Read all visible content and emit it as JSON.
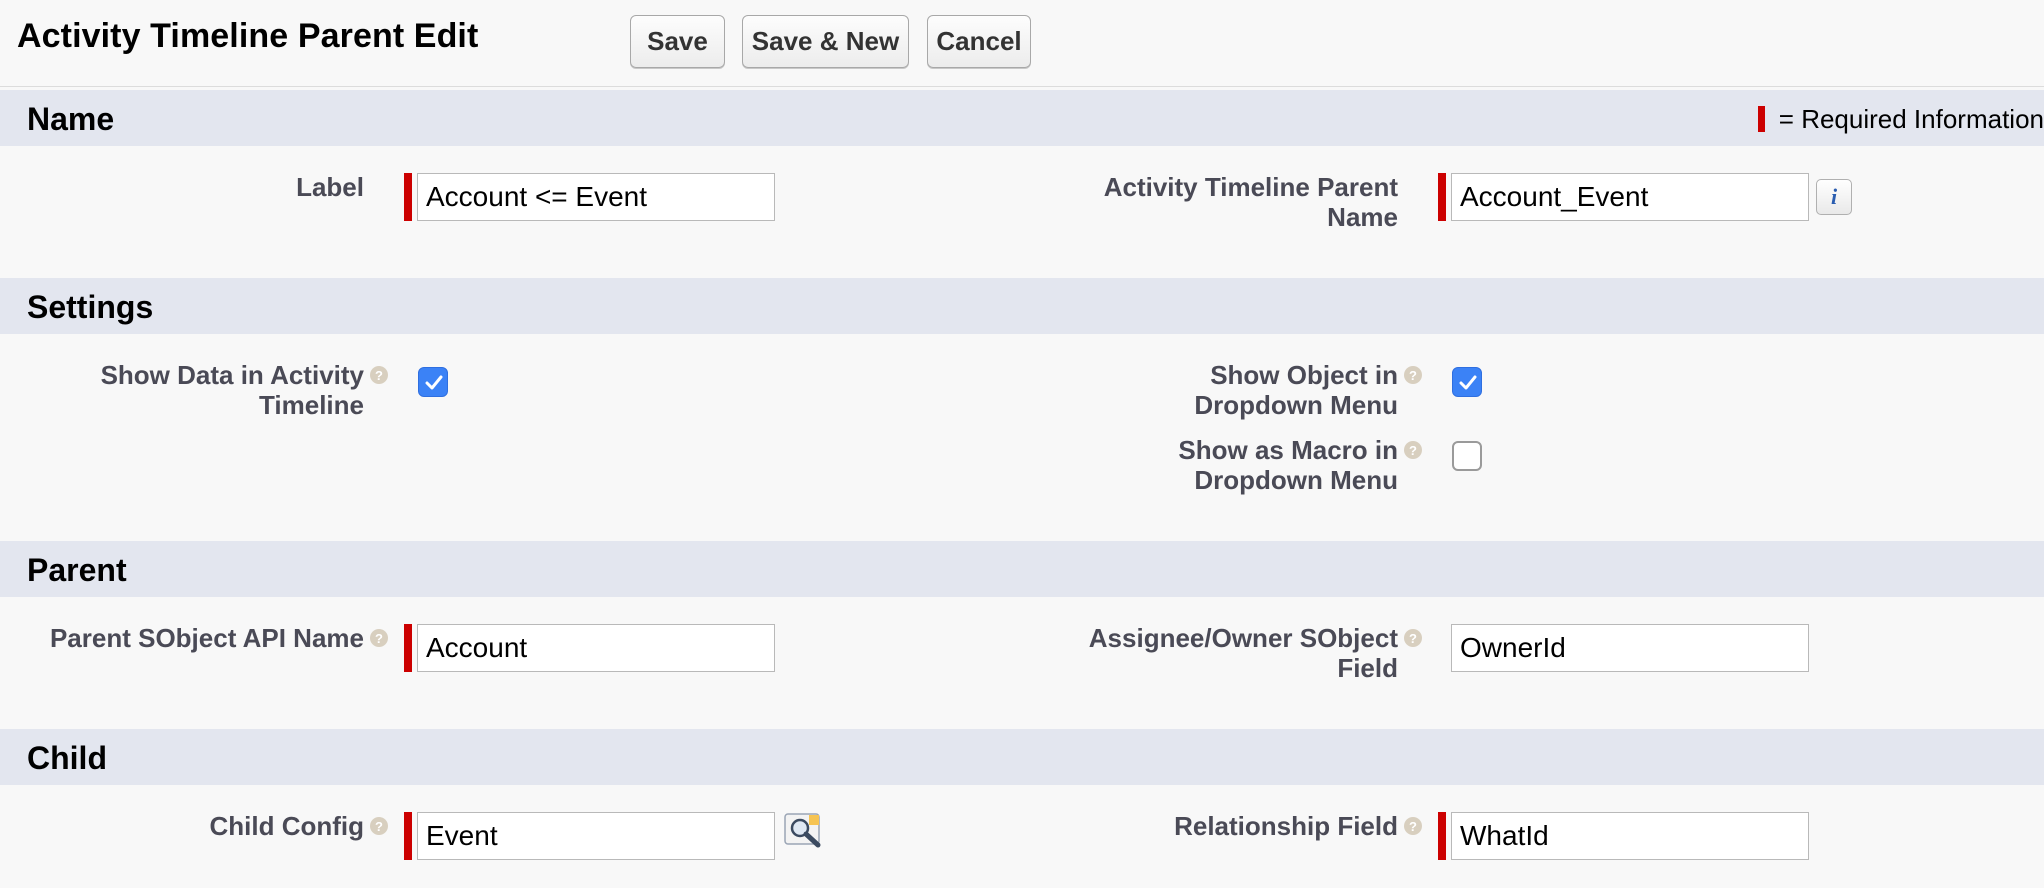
{
  "header": {
    "title": "Activity Timeline Parent Edit",
    "buttons": {
      "save": "Save",
      "save_new": "Save & New",
      "cancel": "Cancel"
    }
  },
  "required_legend": "= Required Information",
  "sections": {
    "name": {
      "title": "Name",
      "label_label": "Label",
      "label_value": "Account <= Event",
      "parent_name_label": "Activity Timeline Parent Name",
      "parent_name_value": "Account_Event"
    },
    "settings": {
      "title": "Settings",
      "show_data_label": "Show Data in Activity Timeline",
      "show_data_checked": true,
      "show_object_label": "Show Object in Dropdown Menu",
      "show_object_checked": true,
      "show_macro_label": "Show as Macro in Dropdown Menu",
      "show_macro_checked": false
    },
    "parent": {
      "title": "Parent",
      "api_name_label": "Parent SObject API Name",
      "api_name_value": "Account",
      "owner_field_label": "Assignee/Owner SObject Field",
      "owner_field_value": "OwnerId"
    },
    "child": {
      "title": "Child",
      "config_label": "Child Config",
      "config_value": "Event",
      "relationship_label": "Relationship Field",
      "relationship_value": "WhatId"
    }
  },
  "icons": {
    "help": "help-icon",
    "info": "info-icon",
    "lookup": "lookup-magnifier-icon",
    "checkbox_color": "#3b82f6",
    "required_color": "#cc0000"
  }
}
